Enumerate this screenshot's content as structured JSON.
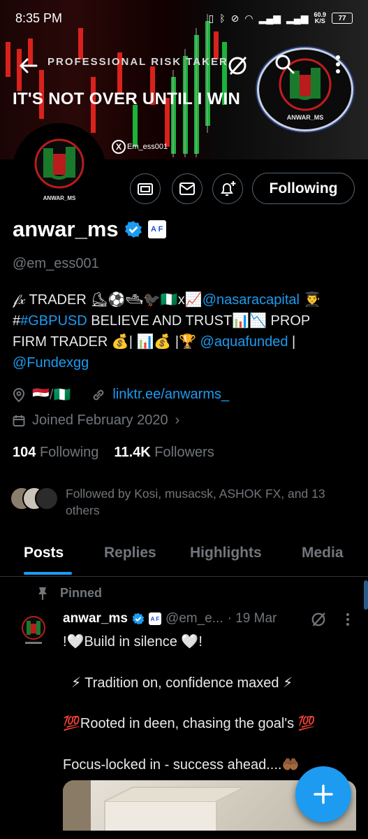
{
  "status_bar": {
    "time": "8:35 PM",
    "network_speed": "60.9\nK/S",
    "battery": "77"
  },
  "banner": {
    "top_title": "PROFESSIONAL RISK TAKER",
    "big_text": "IT'S NOT OVER UNTIL I WIN",
    "x_tag": "Em_ess001",
    "logo_text": "ANWAR_MS"
  },
  "actions": {
    "following_label": "Following"
  },
  "profile": {
    "display_name": "anwar_ms",
    "badge": "A F",
    "handle": "@em_ess001",
    "bio": {
      "line1_prefix": "𝒻𝓍 TRADER ⛸⚽🛥🐦‍⬛🇳🇬x📈",
      "mention1": "@nasaracapital",
      "line1_suffix": " 👨‍🎓",
      "hash_prefix": "#",
      "hashtag": "#GBPUSD",
      "line2_rest": " BELIEVE AND TRUST📊📉 PROP",
      "line3_prefix": "FIRM TRADER 💰| 📊💰 |🏆 ",
      "mention2": "@aquafunded",
      "line3_suffix": " |",
      "mention3": "@Fundexgg"
    },
    "location": "🇪🇬/🇳🇬",
    "website": "linktr.ee/anwarms_",
    "joined": "Joined February 2020",
    "following_count": "104",
    "following_label": "Following",
    "followers_count": "11.4K",
    "followers_label": "Followers",
    "followed_by": "Followed by Kosi, musacsk, ASHOK FX, and 13 others"
  },
  "tabs": [
    {
      "label": "Posts"
    },
    {
      "label": "Replies"
    },
    {
      "label": "Highlights"
    },
    {
      "label": "Media"
    }
  ],
  "post": {
    "pinned_label": "Pinned",
    "name": "anwar_ms",
    "badge": "A F",
    "handle": "@em_e...",
    "date": "· 19 Mar",
    "lines": [
      "!🤍Build in silence 🤍!",
      "⚡ Tradition on, confidence maxed ⚡",
      "💯Rooted in deen, chasing the goal's 💯",
      "Focus-locked in - success ahead....🤲🏾"
    ]
  },
  "colors": {
    "accent": "#1d9bf0",
    "background": "#000000",
    "muted_text": "#71767b",
    "border": "#536471"
  },
  "icons": {
    "back": "arrow-left-icon",
    "grok": "grok-icon",
    "search": "search-icon",
    "more": "more-vertical-icon",
    "tip": "tip-jar-icon",
    "message": "envelope-icon",
    "notify": "bell-plus-icon",
    "location": "location-pin-icon",
    "link": "link-icon",
    "calendar": "calendar-icon",
    "pin": "pin-icon",
    "compose": "plus-icon"
  }
}
